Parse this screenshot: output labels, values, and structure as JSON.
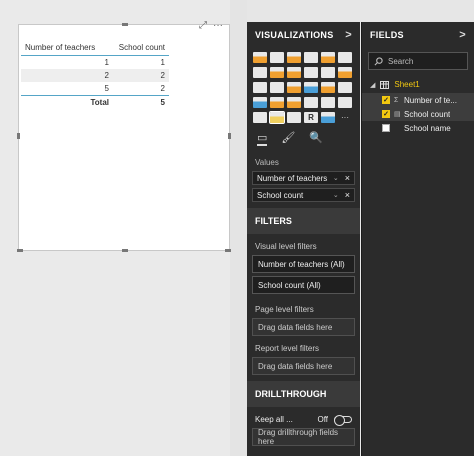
{
  "visual": {
    "menu_glyph": "···",
    "focus_glyph": "⤢",
    "table": {
      "headers": [
        "Number of teachers",
        "School count"
      ],
      "rows": [
        [
          "1",
          "1"
        ],
        [
          "2",
          "2"
        ],
        [
          "5",
          "2"
        ]
      ],
      "total_label": "Total",
      "total_value": "5"
    }
  },
  "visualizations": {
    "title": "VISUALIZATIONS",
    "chevron": ">",
    "icons": [
      {
        "name": "stacked-bar-icon",
        "color": "#f0a030"
      },
      {
        "name": "stacked-column-icon",
        "color": "#e8e8e8"
      },
      {
        "name": "clustered-bar-icon",
        "color": "#f0a030"
      },
      {
        "name": "clustered-column-icon",
        "color": "#e8e8e8"
      },
      {
        "name": "100-bar-icon",
        "color": "#f0a030"
      },
      {
        "name": "100-column-icon",
        "color": "#e8e8e8"
      },
      {
        "name": "line-chart-icon",
        "color": "#e8e8e8"
      },
      {
        "name": "area-chart-icon",
        "color": "#f0a030"
      },
      {
        "name": "stacked-area-icon",
        "color": "#f0a030"
      },
      {
        "name": "line-column-icon",
        "color": "#e8e8e8"
      },
      {
        "name": "line-stacked-column-icon",
        "color": "#e8e8e8"
      },
      {
        "name": "ribbon-chart-icon",
        "color": "#f0a030"
      },
      {
        "name": "waterfall-icon",
        "color": "#e8e8e8"
      },
      {
        "name": "scatter-icon",
        "color": "#e8e8e8"
      },
      {
        "name": "pie-chart-icon",
        "color": "#f0a030"
      },
      {
        "name": "donut-chart-icon",
        "color": "#4a9fd8"
      },
      {
        "name": "treemap-icon",
        "color": "#f0a030"
      },
      {
        "name": "map-icon",
        "color": "#e8e8e8"
      },
      {
        "name": "filled-map-icon",
        "color": "#4a9fd8"
      },
      {
        "name": "funnel-icon",
        "color": "#f0a030"
      },
      {
        "name": "gauge-icon",
        "color": "#f0a030"
      },
      {
        "name": "card-icon",
        "color": "#e8e8e8"
      },
      {
        "name": "multi-row-card-icon",
        "color": "#e8e8e8"
      },
      {
        "name": "kpi-icon",
        "color": "#e8e8e8"
      },
      {
        "name": "slicer-icon",
        "color": "#e8e8e8"
      },
      {
        "name": "table-icon",
        "color": "#f0d060"
      },
      {
        "name": "matrix-icon",
        "color": "#e8e8e8"
      },
      {
        "name": "r-script-icon",
        "color": "#e8e8e8"
      },
      {
        "name": "globe-icon",
        "color": "#4a9fd8"
      },
      {
        "name": "more-visuals-icon",
        "color": "#2b2b2b"
      }
    ],
    "tools": {
      "fields_glyph": "▭",
      "format_glyph": "🖌",
      "analytics_glyph": "🔍"
    },
    "values_label": "Values",
    "wells": [
      {
        "label": "Number of teachers",
        "dropdown": "⌄",
        "remove": "×"
      },
      {
        "label": "School count",
        "dropdown": "⌄",
        "remove": "×"
      }
    ]
  },
  "filters": {
    "title": "FILTERS",
    "visual_level_label": "Visual level filters",
    "visual_filters": [
      "Number of teachers (All)",
      "School count (All)"
    ],
    "page_level_label": "Page level filters",
    "page_drop": "Drag data fields here",
    "report_level_label": "Report level filters",
    "report_drop": "Drag data fields here"
  },
  "drillthrough": {
    "title": "DRILLTHROUGH",
    "keep_all_label": "Keep all ...",
    "toggle_state": "Off",
    "drop": "Drag drillthrough fields here"
  },
  "fields": {
    "title": "FIELDS",
    "chevron": ">",
    "search_placeholder": "Search",
    "table_name": "Sheet1",
    "items": [
      {
        "name": "Number of te...",
        "checked": true,
        "type": "Σ",
        "type_icon": "sigma-icon"
      },
      {
        "name": "School count",
        "checked": true,
        "type": "▤",
        "type_icon": "calculated-field-icon"
      },
      {
        "name": "School name",
        "checked": false,
        "type": "",
        "type_icon": ""
      }
    ]
  }
}
